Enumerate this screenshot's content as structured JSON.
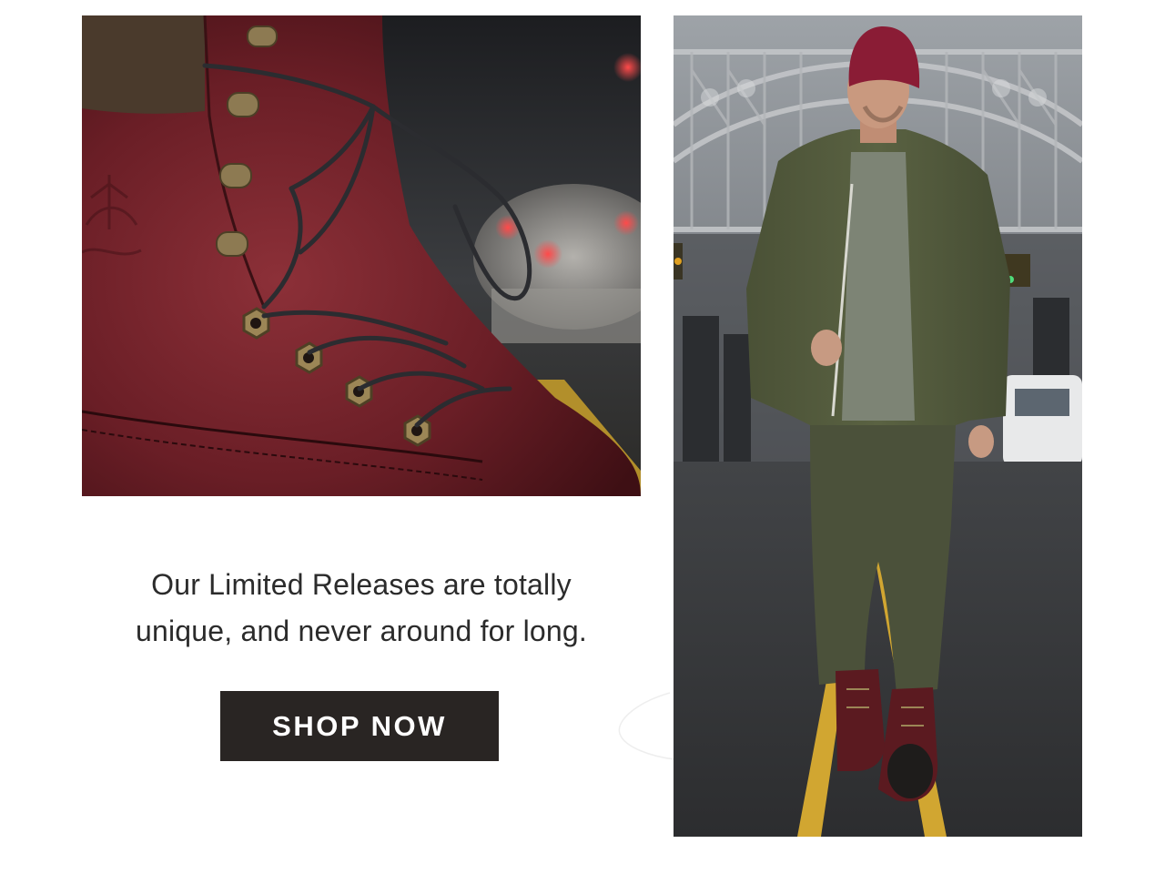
{
  "promo": {
    "copy_line_1": "Our Limited Releases are totally",
    "copy_line_2": "unique, and never around for long.",
    "cta_label": "SHOP NOW"
  },
  "images": {
    "left": "boot-closeup-photo",
    "right": "model-walking-street-photo"
  },
  "colors": {
    "button_bg": "#292523",
    "button_text": "#ffffff",
    "text": "#2b2b2b",
    "boot_leather": "#6b1f26",
    "jacket": "#4e5539",
    "beanie": "#8a1c35"
  }
}
